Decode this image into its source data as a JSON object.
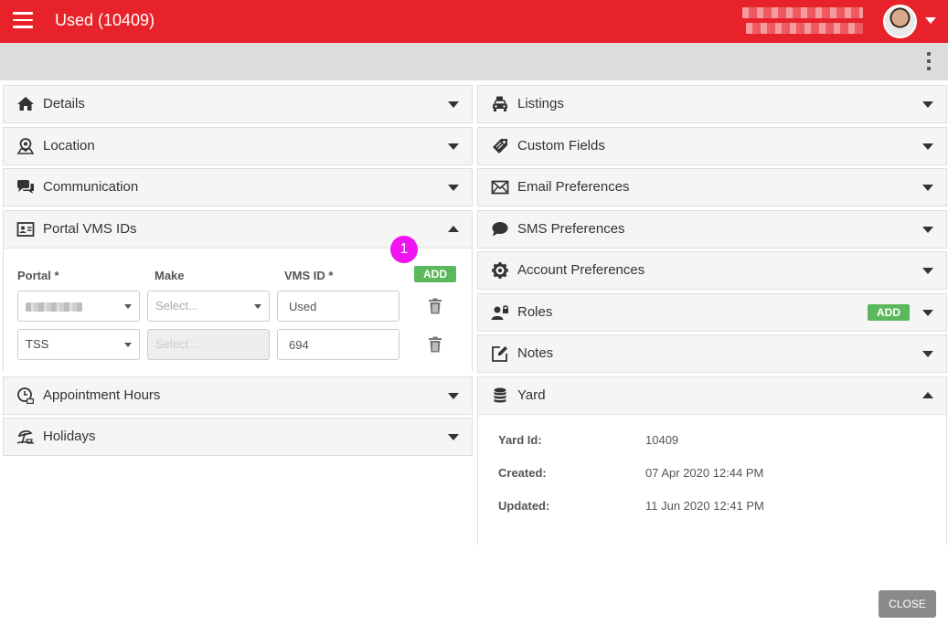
{
  "header": {
    "title": "Used (10409)"
  },
  "left_panels": [
    {
      "id": "details",
      "title": "Details",
      "icon": "home-icon"
    },
    {
      "id": "location",
      "title": "Location",
      "icon": "map-pin-icon"
    },
    {
      "id": "communication",
      "title": "Communication",
      "icon": "chat-icon"
    },
    {
      "id": "portal",
      "title": "Portal VMS IDs",
      "icon": "id-card-icon"
    },
    {
      "id": "appointment",
      "title": "Appointment Hours",
      "icon": "clock-icon"
    },
    {
      "id": "holidays",
      "title": "Holidays",
      "icon": "beach-umbrella-icon"
    }
  ],
  "portal": {
    "add_label": "ADD",
    "badge": "1",
    "col_portal": "Portal *",
    "col_make": "Make",
    "col_vms": "VMS ID *",
    "rows": [
      {
        "portal": "",
        "make_placeholder": "Select...",
        "vms_id": "Used"
      },
      {
        "portal": "TSS",
        "make_placeholder": "Select...",
        "vms_id": "694"
      }
    ]
  },
  "right_panels": [
    {
      "id": "listings",
      "title": "Listings",
      "icon": "car-icon"
    },
    {
      "id": "custom",
      "title": "Custom Fields",
      "icon": "tag-icon"
    },
    {
      "id": "email",
      "title": "Email Preferences",
      "icon": "envelope-icon"
    },
    {
      "id": "sms",
      "title": "SMS Preferences",
      "icon": "speech-bubble-icon"
    },
    {
      "id": "account",
      "title": "Account Preferences",
      "icon": "gear-icon"
    },
    {
      "id": "roles",
      "title": "Roles",
      "icon": "user-lock-icon"
    },
    {
      "id": "notes",
      "title": "Notes",
      "icon": "edit-note-icon"
    },
    {
      "id": "yard",
      "title": "Yard",
      "icon": "database-icon"
    }
  ],
  "roles": {
    "add_label": "ADD"
  },
  "yard": {
    "rows": [
      {
        "label": "Yard Id:",
        "value": "10409"
      },
      {
        "label": "Created:",
        "value": "07 Apr 2020 12:44 PM"
      },
      {
        "label": "Updated:",
        "value": "11 Jun 2020 12:41 PM"
      }
    ]
  },
  "footer": {
    "close_label": "CLOSE"
  },
  "colors": {
    "header_bg": "#e8222a",
    "add_green": "#5cb85c",
    "badge_magenta": "#f015f0",
    "close_gray": "#8a8a8a"
  }
}
